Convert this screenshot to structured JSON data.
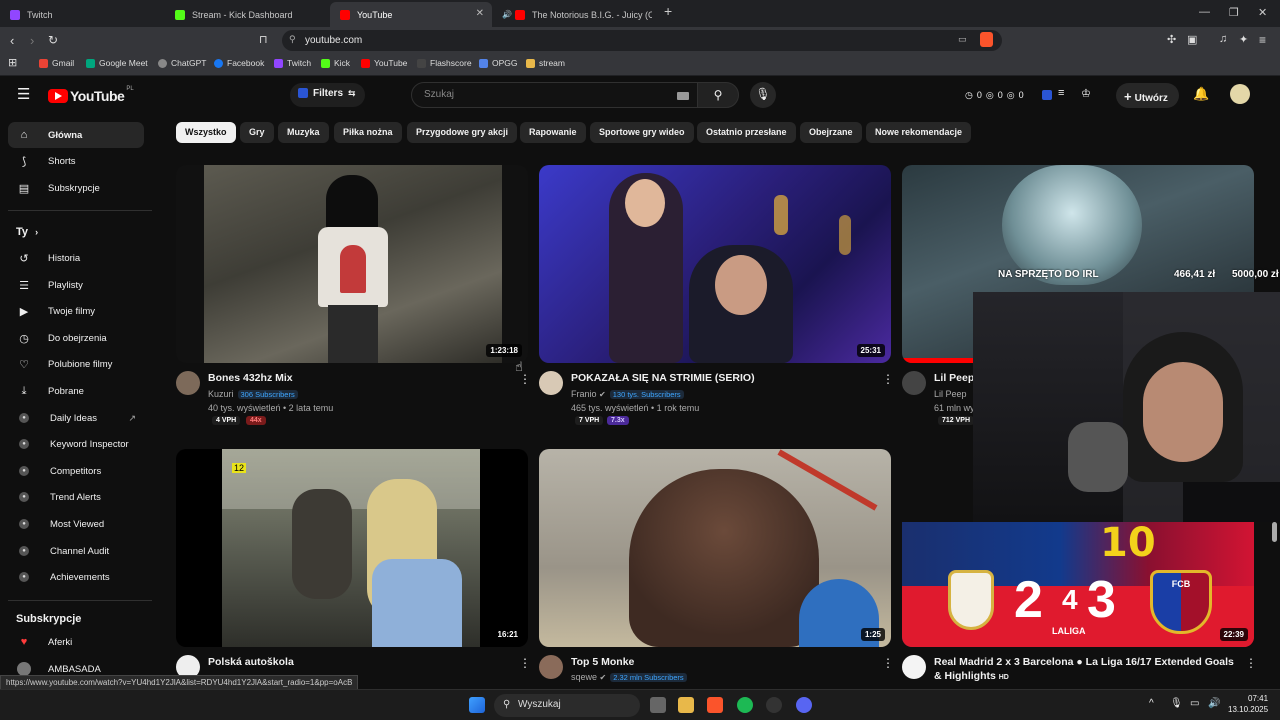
{
  "tabs": [
    {
      "title": "Twitch",
      "color": "#9146ff"
    },
    {
      "title": "Stream - Kick Dashboard",
      "color": "#53fc18"
    },
    {
      "title": "YouTube",
      "color": "#ff0000"
    },
    {
      "title": "The Notorious B.I.G. - Juicy (Offic",
      "color": "#ff0000"
    }
  ],
  "address": {
    "url": "youtube.com"
  },
  "bookmarks": [
    "Gmail",
    "Google Meet",
    "ChatGPT",
    "Facebook",
    "Twitch",
    "Kick",
    "YouTube",
    "Flashscore",
    "OPGG",
    "stream"
  ],
  "header": {
    "logo": "YouTube",
    "country": "PL",
    "filters_label": "Filters",
    "search_placeholder": "Szukaj",
    "counter1": "0",
    "counter2": "0",
    "counter3": "0",
    "create_label": "Utwórz"
  },
  "sidebar": {
    "main": [
      {
        "label": "Główna",
        "icon": "home-icon"
      },
      {
        "label": "Shorts",
        "icon": "shorts-icon"
      },
      {
        "label": "Subskrypcje",
        "icon": "subscriptions-icon"
      }
    ],
    "you_header": "Ty",
    "you": [
      {
        "label": "Historia",
        "icon": "history-icon"
      },
      {
        "label": "Playlisty",
        "icon": "playlist-icon"
      },
      {
        "label": "Twoje filmy",
        "icon": "your-videos-icon"
      },
      {
        "label": "Do obejrzenia",
        "icon": "watch-later-icon"
      },
      {
        "label": "Polubione filmy",
        "icon": "liked-icon"
      },
      {
        "label": "Pobrane",
        "icon": "download-icon"
      }
    ],
    "tools": [
      {
        "label": "Daily Ideas"
      },
      {
        "label": "Keyword Inspector"
      },
      {
        "label": "Competitors"
      },
      {
        "label": "Trend Alerts"
      },
      {
        "label": "Most Viewed"
      },
      {
        "label": "Channel Audit"
      },
      {
        "label": "Achievements"
      }
    ],
    "subs_header": "Subskrypcje",
    "subs": [
      "Aferki",
      "AMBASADA"
    ]
  },
  "chips": [
    "Wszystko",
    "Gry",
    "Muzyka",
    "Piłka nożna",
    "Przygodowe gry akcji",
    "Rapowanie",
    "Sportowe gry wideo",
    "Ostatnio przesłane",
    "Obejrzane",
    "Nowe rekomendacje"
  ],
  "videos": [
    {
      "title": "Bones 432hz Mix",
      "channel": "Kuzuri",
      "subs": "306 Subscribers",
      "meta": "40 tys. wyświetleń • 2 lata temu",
      "duration": "1:23:18",
      "vph": "4 VPH",
      "mult": "44x"
    },
    {
      "title": "POKAZAŁA SIĘ NA STRIMIE (SERIO)",
      "channel": "Franio",
      "subs": "130 tys. Subscribers",
      "meta": "465 tys. wyświetleń • 1 rok temu",
      "duration": "25:31",
      "vph": "7 VPH",
      "mult": "7.3x"
    },
    {
      "title": "Lil Peep",
      "channel": "Lil Peep",
      "meta": "61 mln wy",
      "vph": "712 VPH"
    },
    {
      "title": "Polská autoškola",
      "duration": "16:21"
    },
    {
      "title": "Top 5 Monke",
      "channel": "sqewe",
      "subs": "2.32 mln Subscribers",
      "duration": "1:25"
    },
    {
      "title": "Real Madrid 2 x 3 Barcelona ● La Liga 16/17 Extended Goals & Highlights",
      "hd": "HD",
      "duration": "22:39",
      "score_left": "2",
      "score_right": "3",
      "score_sep": "4",
      "league": "LALIGA",
      "jersey": "10",
      "crest_right": "FCB"
    }
  ],
  "overlay": {
    "label": "NA SPRZĘTO DO IRL",
    "amount": "466,41 zł",
    "goal": "5000,00 zł"
  },
  "statusbar": {
    "url": "https://www.youtube.com/watch?v=YU4hd1Y2JlA&list=RDYU4hd1Y2JlA&start_radio=1&pp=oAcB"
  },
  "taskbar": {
    "search": "Wyszukaj",
    "time": "07:41",
    "date": "13.10.2025"
  }
}
